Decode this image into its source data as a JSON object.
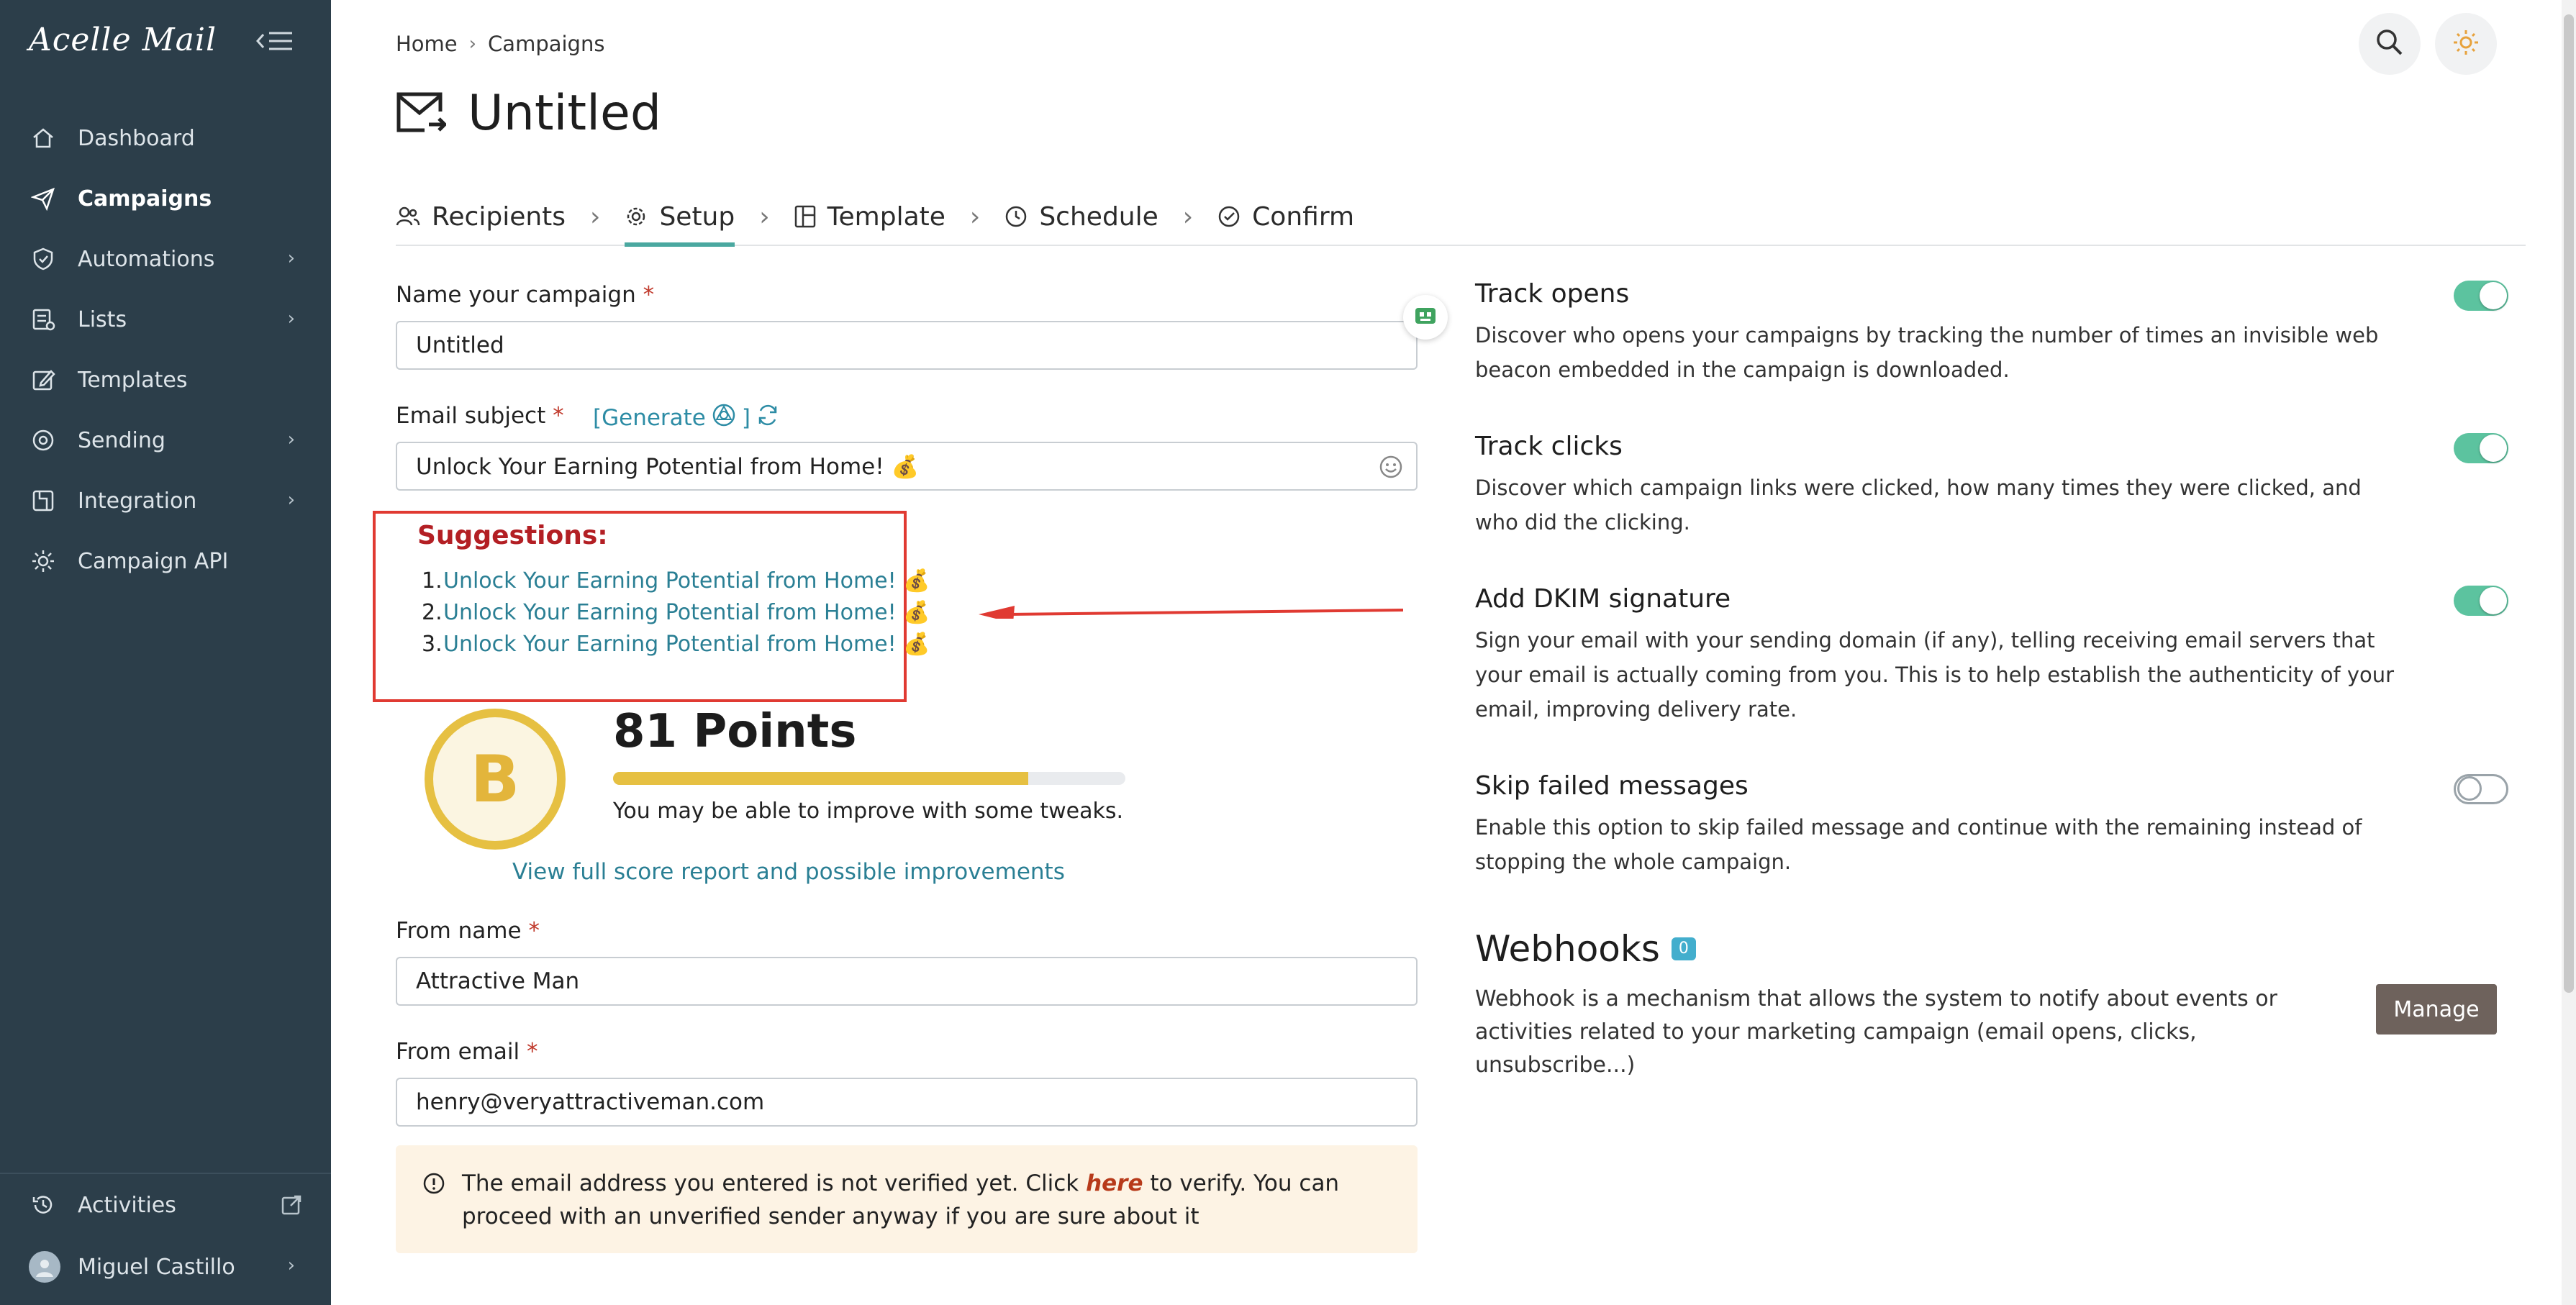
{
  "app": {
    "logo": "Acelle Mail"
  },
  "sidebar": {
    "items": [
      {
        "label": "Dashboard",
        "icon": "home-icon",
        "active": false,
        "submenu": false
      },
      {
        "label": "Campaigns",
        "icon": "paper-plane-icon",
        "active": true,
        "submenu": false
      },
      {
        "label": "Automations",
        "icon": "automation-icon",
        "active": false,
        "submenu": true
      },
      {
        "label": "Lists",
        "icon": "list-icon",
        "active": false,
        "submenu": true
      },
      {
        "label": "Templates",
        "icon": "template-edit-icon",
        "active": false,
        "submenu": false
      },
      {
        "label": "Sending",
        "icon": "sending-icon",
        "active": false,
        "submenu": true
      },
      {
        "label": "Integration",
        "icon": "integration-icon",
        "active": false,
        "submenu": true
      },
      {
        "label": "Campaign API",
        "icon": "api-gear-icon",
        "active": false,
        "submenu": false
      }
    ],
    "bottom": {
      "activities": "Activities",
      "user": "Miguel Castillo"
    }
  },
  "breadcrumb": {
    "home": "Home",
    "current": "Campaigns"
  },
  "page": {
    "title": "Untitled"
  },
  "steps": [
    {
      "label": "Recipients",
      "icon": "users-icon",
      "active": false
    },
    {
      "label": "Setup",
      "icon": "gear-icon",
      "active": true
    },
    {
      "label": "Template",
      "icon": "layout-icon",
      "active": false
    },
    {
      "label": "Schedule",
      "icon": "clock-icon",
      "active": false
    },
    {
      "label": "Confirm",
      "icon": "check-circle-icon",
      "active": false
    }
  ],
  "form": {
    "campaign_name": {
      "label": "Name your campaign",
      "value": "Untitled"
    },
    "subject": {
      "label": "Email subject",
      "generate": "[Generate",
      "generate_close": "]",
      "value": "Unlock Your Earning Potential from Home! 💰"
    },
    "suggestions": {
      "title": "Suggestions:",
      "items": [
        "Unlock Your Earning Potential from Home! 💰",
        "Unlock Your Earning Potential from Home! 💰",
        "Unlock Your Earning Potential from Home! 💰"
      ]
    },
    "score": {
      "grade": "B",
      "points": "81 Points",
      "progress_pct": 81,
      "hint": "You may be able to improve with some tweaks.",
      "link": "View full score report and possible improvements"
    },
    "from_name": {
      "label": "From name",
      "value": "Attractive Man"
    },
    "from_email": {
      "label": "From email",
      "value": "henry@veryattractiveman.com"
    },
    "warning": {
      "before": "The email address you entered is not verified yet. Click ",
      "link": "here",
      "after": " to verify. You can proceed with an unverified sender anyway if you are sure about it"
    }
  },
  "options": {
    "track_opens": {
      "title": "Track opens",
      "desc": "Discover who opens your campaigns by tracking the number of times an invisible web beacon embedded in the campaign is downloaded.",
      "enabled": true
    },
    "track_clicks": {
      "title": "Track clicks",
      "desc": "Discover which campaign links were clicked, how many times they were clicked, and who did the clicking.",
      "enabled": true
    },
    "dkim": {
      "title": "Add DKIM signature",
      "desc": "Sign your email with your sending domain (if any), telling receiving email servers that your email is actually coming from you. This is to help establish the authenticity of your email, improving delivery rate.",
      "enabled": true
    },
    "skip_failed": {
      "title": "Skip failed messages",
      "desc": "Enable this option to skip failed message and continue with the remaining instead of stopping the whole campaign.",
      "enabled": false
    }
  },
  "webhooks": {
    "title": "Webhooks",
    "count": "0",
    "desc": "Webhook is a mechanism that allows the system to notify about events or activities related to your marketing campaign (email opens, clicks, unsubscribe...)",
    "manage": "Manage"
  },
  "colors": {
    "sidebar_bg": "#2c3e4a",
    "accent_teal": "#4aa8a0",
    "toggle_on": "#5cc39f",
    "link": "#2a7f94",
    "suggest_border": "#e03a32",
    "grade_yellow": "#e6c042",
    "warning_bg": "#fdf3e4",
    "manage_btn": "#6e625c"
  }
}
